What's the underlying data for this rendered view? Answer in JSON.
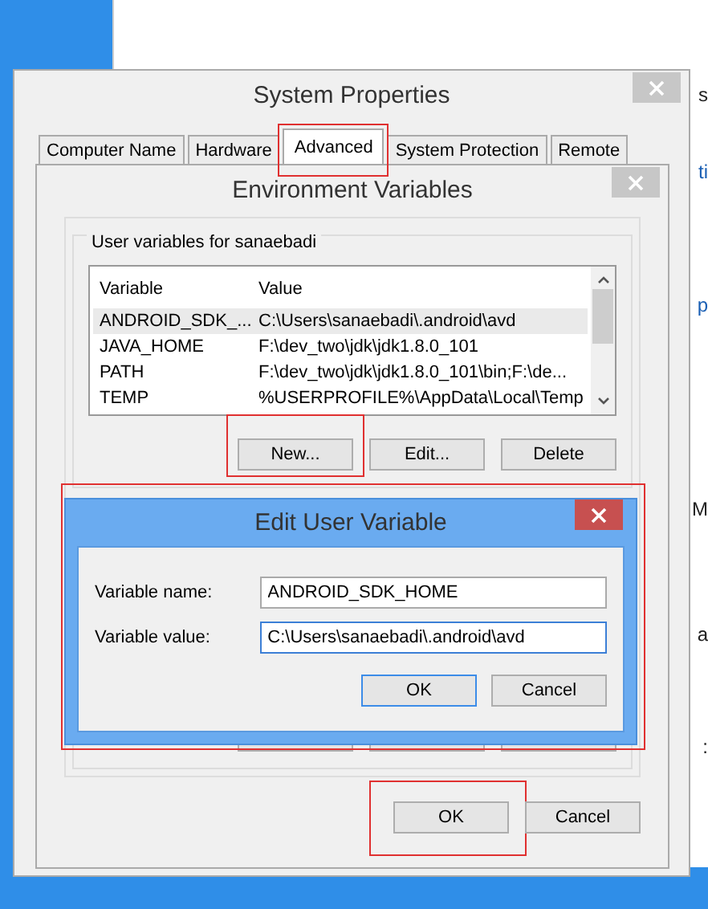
{
  "background_window": {
    "fragments": [
      "s",
      "ti",
      "p",
      "M",
      "a",
      ":"
    ]
  },
  "system_properties": {
    "title": "System Properties",
    "tabs": [
      {
        "label": "Computer Name",
        "selected": false,
        "highlighted": false
      },
      {
        "label": "Hardware",
        "selected": false,
        "highlighted": false
      },
      {
        "label": "Advanced",
        "selected": true,
        "highlighted": true
      },
      {
        "label": "System Protection",
        "selected": false,
        "highlighted": false
      },
      {
        "label": "Remote",
        "selected": false,
        "highlighted": false
      }
    ]
  },
  "environment_variables": {
    "title": "Environment Variables",
    "user_group": {
      "title": "User variables for sanaebadi",
      "columns": [
        "Variable",
        "Value"
      ],
      "rows": [
        {
          "variable": "ANDROID_SDK_...",
          "value": "C:\\Users\\sanaebadi\\.android\\avd",
          "selected": true
        },
        {
          "variable": "JAVA_HOME",
          "value": "F:\\dev_two\\jdk\\jdk1.8.0_101",
          "selected": false
        },
        {
          "variable": "PATH",
          "value": "F:\\dev_two\\jdk\\jdk1.8.0_101\\bin;F:\\de...",
          "selected": false
        },
        {
          "variable": "TEMP",
          "value": "%USERPROFILE%\\AppData\\Local\\Temp",
          "selected": false
        }
      ],
      "buttons": [
        {
          "label": "New...",
          "highlighted": true
        },
        {
          "label": "Edit...",
          "highlighted": false
        },
        {
          "label": "Delete",
          "highlighted": false
        }
      ]
    },
    "buttons": [
      {
        "label": "OK",
        "highlighted": true
      },
      {
        "label": "Cancel",
        "highlighted": false
      }
    ]
  },
  "edit_dialog": {
    "title": "Edit User Variable",
    "highlighted": true,
    "fields": [
      {
        "label": "Variable name:",
        "value": "ANDROID_SDK_HOME",
        "focused": false
      },
      {
        "label": "Variable value:",
        "value": "C:\\Users\\sanaebadi\\.android\\avd",
        "focused": true
      }
    ],
    "buttons": [
      {
        "label": "OK",
        "default": true
      },
      {
        "label": "Cancel",
        "default": false
      }
    ]
  }
}
